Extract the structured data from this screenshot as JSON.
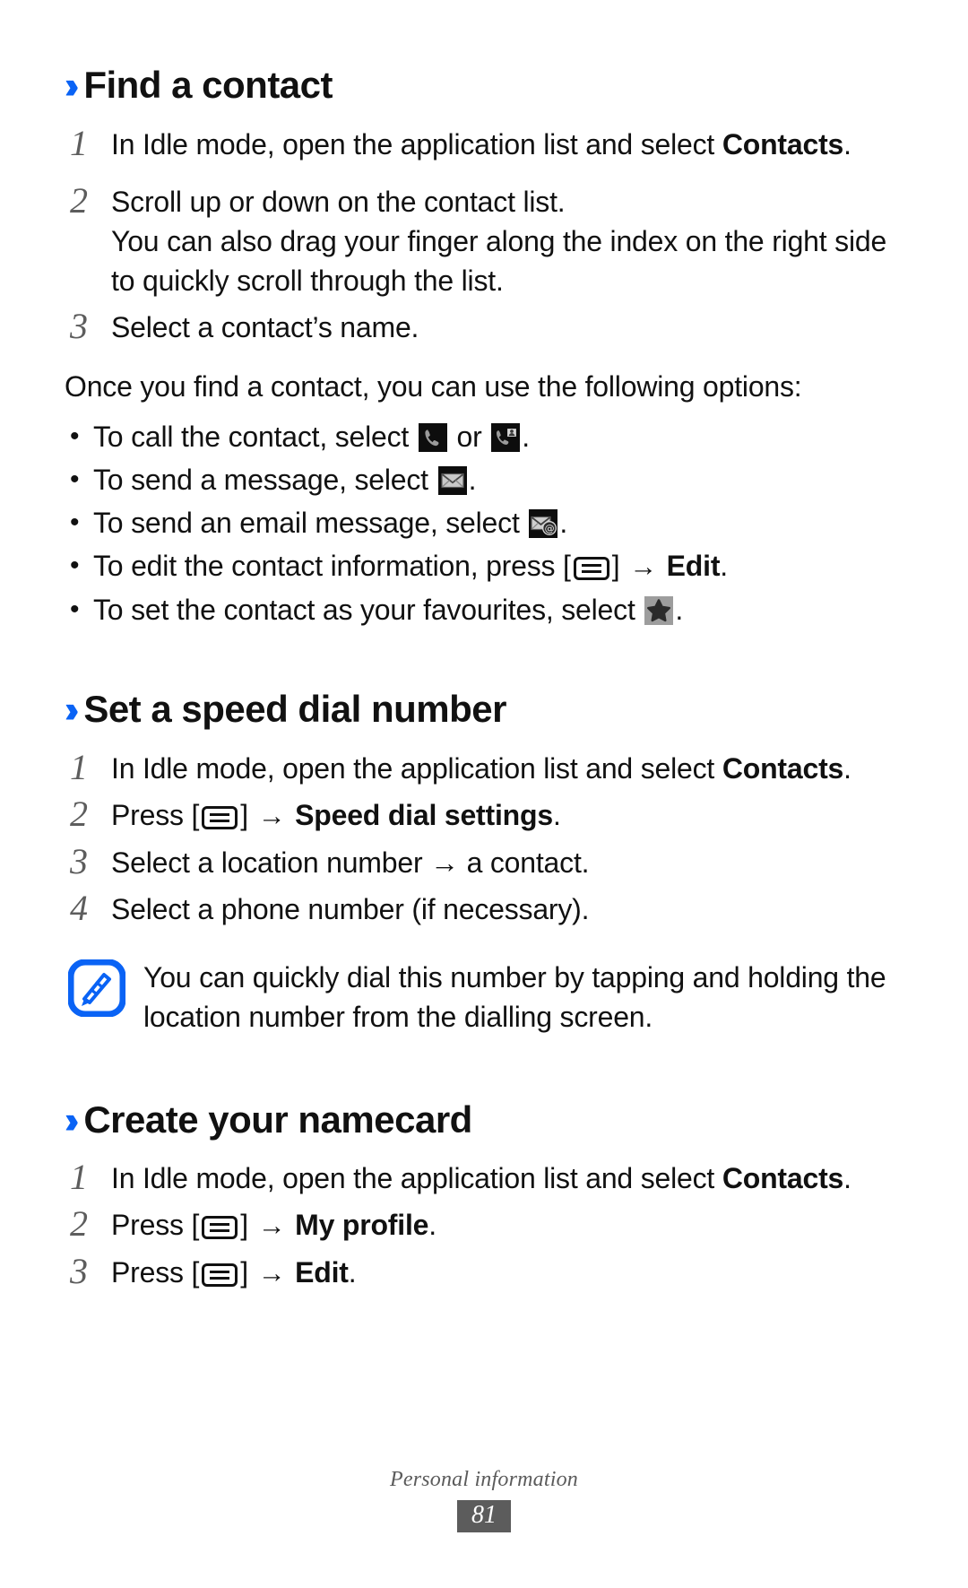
{
  "document": {
    "footer_title": "Personal information",
    "page_number": "81",
    "accent_color": "#0a63f5",
    "chevron_glyph": "››"
  },
  "sections": [
    {
      "id": "find-a-contact",
      "heading": "Find a contact",
      "steps": [
        {
          "num": "1",
          "text_before": "In Idle mode, open the application list and select ",
          "bold": "Contacts",
          "text_after": "."
        },
        {
          "num": "2",
          "text": "Scroll up or down on the contact list.",
          "extra": "You can also drag your finger along the index on the right side to quickly scroll through the list."
        },
        {
          "num": "3",
          "text": "Select a contact’s name."
        }
      ],
      "paragraph": "Once you find a contact, you can use the following options:",
      "bullets": [
        {
          "before": "To call the contact, select ",
          "icon1": "phone-call-icon",
          "middle": " or ",
          "icon2": "video-call-icon",
          "after": "."
        },
        {
          "before": "To send a message, select ",
          "icon1": "message-envelope-icon",
          "after": "."
        },
        {
          "before": "To send an email message, select ",
          "icon1": "email-at-icon",
          "after": "."
        },
        {
          "before": "To edit the contact information, press ",
          "icon1": "menu-key-icon",
          "arrow": "→",
          "bold": "Edit",
          "after": "."
        },
        {
          "before": "To set the contact as your favourites, select ",
          "icon1": "favourite-star-icon",
          "after": "."
        }
      ]
    },
    {
      "id": "set-a-speed-dial-number",
      "heading": "Set a speed dial number",
      "steps": [
        {
          "num": "1",
          "text_before": "In Idle mode, open the application list and select ",
          "bold": "Contacts",
          "text_after": "."
        },
        {
          "num": "2",
          "text_before": "Press ",
          "icon": "menu-key-icon",
          "arrow": "→",
          "bold": "Speed dial settings",
          "text_after": "."
        },
        {
          "num": "3",
          "text": "Select a location number → a contact."
        },
        {
          "num": "4",
          "text": "Select a phone number (if necessary)."
        }
      ],
      "note": {
        "icon": "note-pen-icon",
        "text": "You can quickly dial this number by tapping and holding the location number from the dialling screen."
      }
    },
    {
      "id": "create-your-namecard",
      "heading": "Create your namecard",
      "steps": [
        {
          "num": "1",
          "text_before": "In Idle mode, open the application list and select ",
          "bold": "Contacts",
          "text_after": "."
        },
        {
          "num": "2",
          "text_before": "Press ",
          "icon": "menu-key-icon",
          "arrow": "→",
          "bold": "My profile",
          "text_after": "."
        },
        {
          "num": "3",
          "text_before": "Press ",
          "icon": "menu-key-icon",
          "arrow": "→",
          "bold": "Edit",
          "text_after": "."
        }
      ]
    }
  ]
}
